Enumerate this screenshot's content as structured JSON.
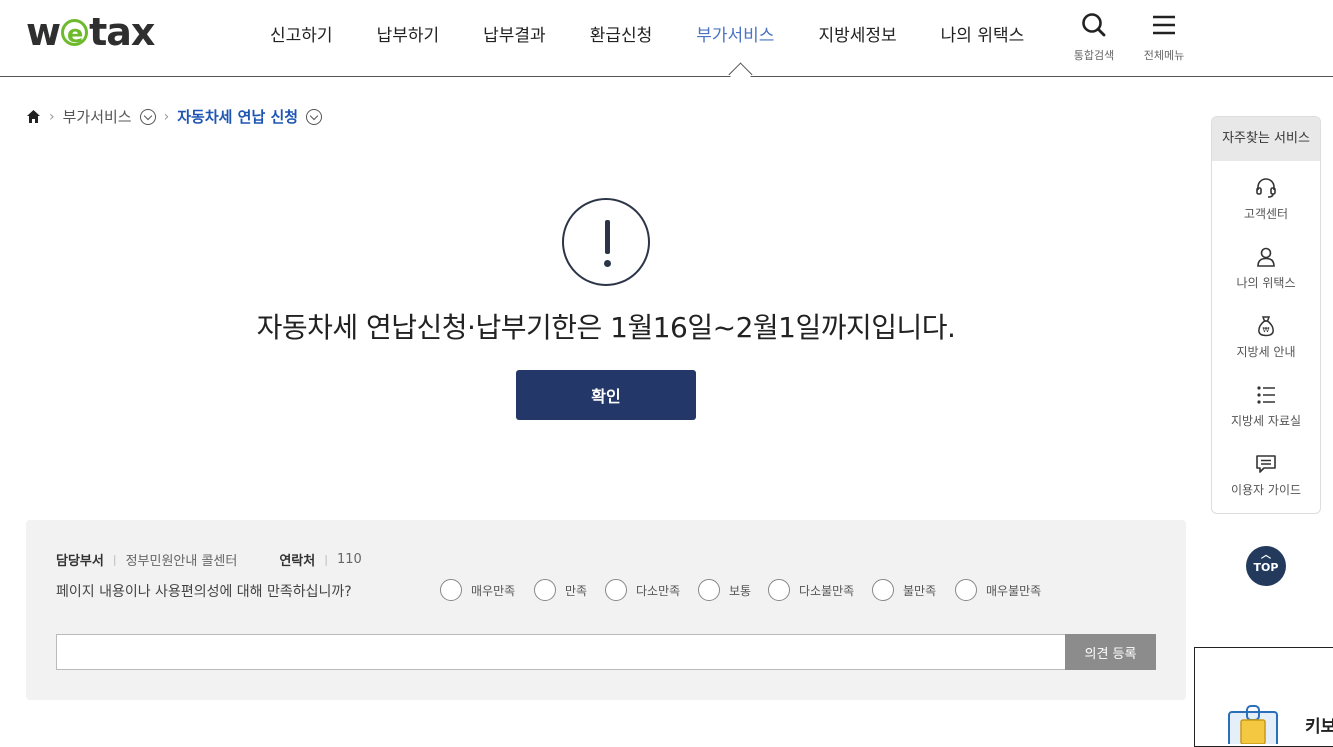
{
  "header": {
    "logo_text": "wetax",
    "nav": [
      "신고하기",
      "납부하기",
      "납부결과",
      "환급신청",
      "부가서비스",
      "지방세정보",
      "나의 위택스"
    ],
    "active_nav": "부가서비스",
    "search_label": "통합검색",
    "menu_label": "전체메뉴"
  },
  "breadcrumb": {
    "level1": "부가서비스",
    "current": "자동차세 연납 신청"
  },
  "alert": {
    "message": "자동차세 연납신청·납부기한은 1월16일~2월1일까지입니다.",
    "confirm_label": "확인"
  },
  "quick": {
    "title": "자주찾는 서비스",
    "items": [
      {
        "label": "고객센터",
        "icon": "headset-icon"
      },
      {
        "label": "나의 위택스",
        "icon": "user-icon"
      },
      {
        "label": "지방세 안내",
        "icon": "money-bag-icon"
      },
      {
        "label": "지방세 자료실",
        "icon": "list-icon"
      },
      {
        "label": "이용자 가이드",
        "icon": "chat-icon"
      }
    ],
    "top_label": "TOP"
  },
  "survey": {
    "dept_key": "담당부서",
    "dept_value": "정부민원안내 콜센터",
    "contact_key": "연락처",
    "contact_value": "110",
    "question": "페이지 내용이나 사용편의성에 대해 만족하십니까?",
    "options": [
      "매우만족",
      "만족",
      "다소만족",
      "보통",
      "다소불만족",
      "불만족",
      "매우불만족"
    ],
    "opinion_value": "",
    "submit_label": "의견 등록"
  },
  "keyboard_panel": {
    "text": "키보"
  },
  "colors": {
    "accent_navy": "#233869",
    "active_nav": "#4a73c3",
    "breadcrumb_current": "#1e55b3",
    "logo_green": "#6dbb2c"
  }
}
